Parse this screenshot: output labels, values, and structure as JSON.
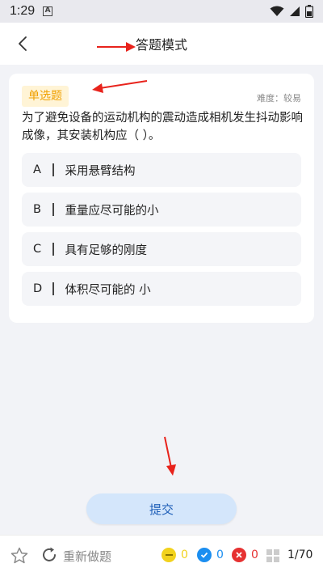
{
  "status_bar": {
    "time": "1:29",
    "notify_glyph": "A"
  },
  "header": {
    "title": "答题模式"
  },
  "question": {
    "type_badge": "单选题",
    "difficulty": "难度：较易",
    "text": "为了避免设备的运动机构的震动造成相机发生抖动影响成像，其安装机构应（   ）。",
    "options": [
      {
        "letter": "A",
        "text": "采用悬臂结构"
      },
      {
        "letter": "B",
        "text": "重量应尽可能的小"
      },
      {
        "letter": "C",
        "text": "具有足够的刚度"
      },
      {
        "letter": "D",
        "text": "体积尽可能的 小"
      }
    ]
  },
  "submit_label": "提交",
  "bottom_bar": {
    "redo_label": "重新做题",
    "unanswered_count": "0",
    "correct_count": "0",
    "wrong_count": "0",
    "progress": "1/70"
  },
  "colors": {
    "unanswered": "#f2d21d",
    "correct": "#1b8ef0",
    "wrong": "#e63232",
    "arrow": "#e8231c"
  }
}
